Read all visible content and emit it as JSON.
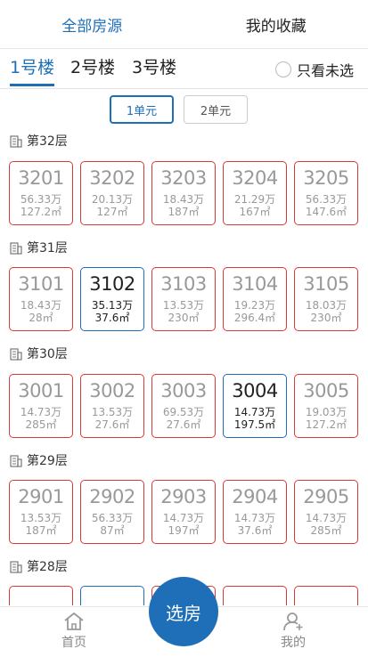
{
  "top_tabs": [
    "全部房源",
    "我的收藏"
  ],
  "buildings": [
    "1号楼",
    "2号楼",
    "3号楼"
  ],
  "only_unsold_label": "只看未选",
  "units": [
    "1单元",
    "2单元"
  ],
  "floors": [
    {
      "label": "第32层",
      "rooms": [
        {
          "no": "3201",
          "price": "56.33万",
          "area": "127.2㎡",
          "available": false
        },
        {
          "no": "3202",
          "price": "20.13万",
          "area": "127㎡",
          "available": false
        },
        {
          "no": "3203",
          "price": "18.43万",
          "area": "187㎡",
          "available": false
        },
        {
          "no": "3204",
          "price": "21.29万",
          "area": "167㎡",
          "available": false
        },
        {
          "no": "3205",
          "price": "56.33万",
          "area": "147.6㎡",
          "available": false
        }
      ]
    },
    {
      "label": "第31层",
      "rooms": [
        {
          "no": "3101",
          "price": "18.43万",
          "area": "28㎡",
          "available": false
        },
        {
          "no": "3102",
          "price": "35.13万",
          "area": "37.6㎡",
          "available": true
        },
        {
          "no": "3103",
          "price": "13.53万",
          "area": "230㎡",
          "available": false
        },
        {
          "no": "3104",
          "price": "19.23万",
          "area": "296.4㎡",
          "available": false
        },
        {
          "no": "3105",
          "price": "18.03万",
          "area": "230㎡",
          "available": false
        }
      ]
    },
    {
      "label": "第30层",
      "rooms": [
        {
          "no": "3001",
          "price": "14.73万",
          "area": "285㎡",
          "available": false
        },
        {
          "no": "3002",
          "price": "13.53万",
          "area": "27.6㎡",
          "available": false
        },
        {
          "no": "3003",
          "price": "69.53万",
          "area": "27.6㎡",
          "available": false
        },
        {
          "no": "3004",
          "price": "14.73万",
          "area": "197.5㎡",
          "available": true
        },
        {
          "no": "3005",
          "price": "19.03万",
          "area": "127.2㎡",
          "available": false
        }
      ]
    },
    {
      "label": "第29层",
      "rooms": [
        {
          "no": "2901",
          "price": "13.53万",
          "area": "187㎡",
          "available": false
        },
        {
          "no": "2902",
          "price": "56.33万",
          "area": "87㎡",
          "available": false
        },
        {
          "no": "2903",
          "price": "14.73万",
          "area": "197㎡",
          "available": false
        },
        {
          "no": "2904",
          "price": "14.73万",
          "area": "37.6㎡",
          "available": false
        },
        {
          "no": "2905",
          "price": "14.73万",
          "area": "285㎡",
          "available": false
        }
      ]
    },
    {
      "label": "第28层",
      "rooms": []
    }
  ],
  "bottom_nav": {
    "home_label": "首页",
    "select_label": "选房",
    "mine_label": "我的"
  },
  "colors": {
    "accent": "#1e6fb8",
    "sold_border": "#d43a3a"
  }
}
